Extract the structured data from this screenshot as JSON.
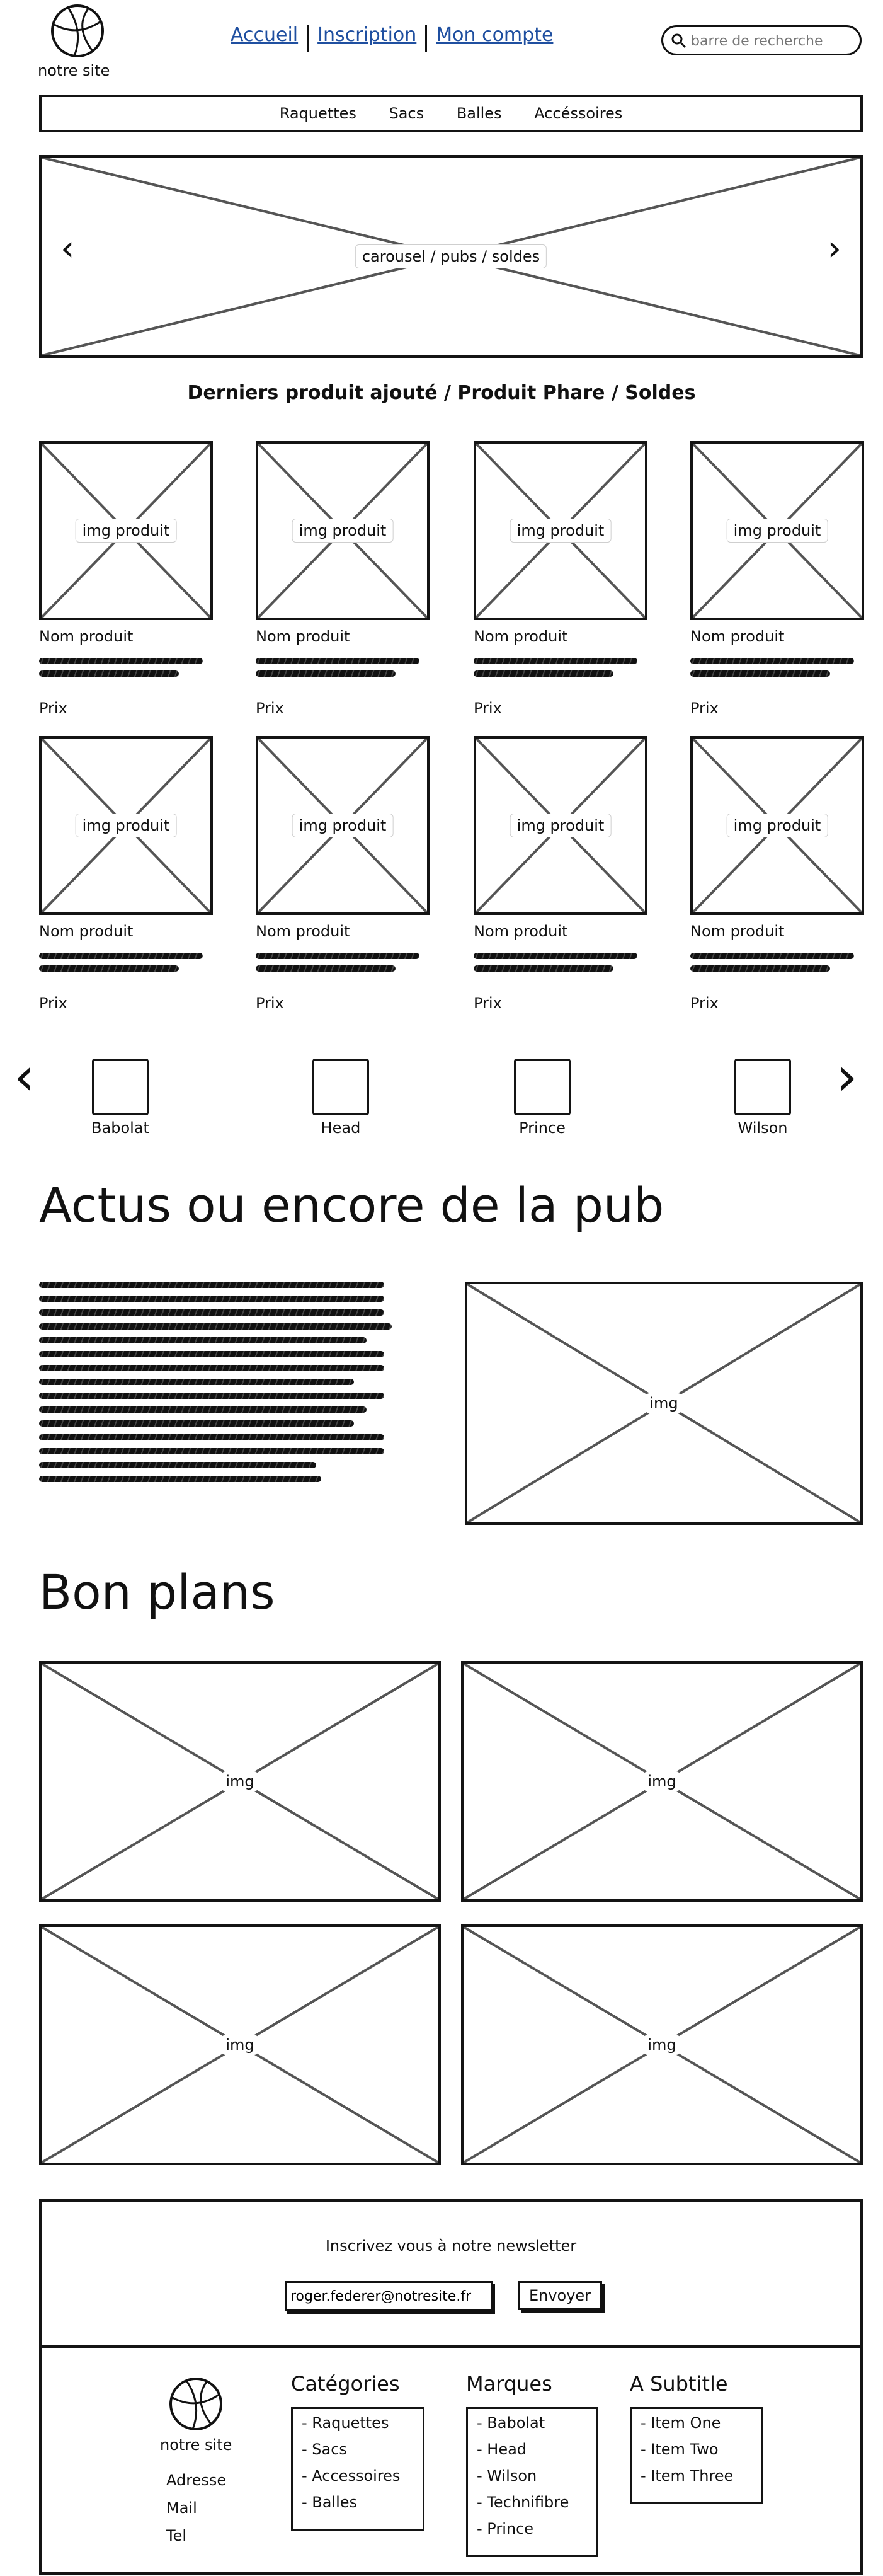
{
  "header": {
    "logo_text": "notre site",
    "nav_links": [
      "Accueil",
      "Inscription",
      "Mon compte"
    ],
    "search_placeholder": "barre de recherche"
  },
  "menu": {
    "items": [
      "Raquettes",
      "Sacs",
      "Balles",
      "Accéssoires"
    ]
  },
  "carousel": {
    "label": "carousel / pubs / soldes",
    "prev": "‹",
    "next": "›"
  },
  "products": {
    "heading": "Derniers produit ajouté / Produit Phare / Soldes",
    "img_label": "img produit",
    "name": "Nom produit",
    "price": "Prix"
  },
  "brands": {
    "items": [
      "Babolat",
      "Head",
      "Prince",
      "Wilson"
    ],
    "prev": "‹",
    "next": "›"
  },
  "news": {
    "title": "Actus ou encore de la pub",
    "img_label": "img"
  },
  "deals": {
    "title": "Bon plans",
    "img_label": "img"
  },
  "newsletter": {
    "text": "Inscrivez vous à notre newsletter",
    "email_value": "roger.federer@notresite.fr",
    "button": "Envoyer"
  },
  "footer": {
    "logo_text": "notre site",
    "contact": [
      "Adresse",
      "Mail",
      "Tel"
    ],
    "columns": [
      {
        "title": "Catégories",
        "items": [
          "- Raquettes",
          "- Sacs",
          "- Accessoires",
          "- Balles"
        ]
      },
      {
        "title": "Marques",
        "items": [
          "- Babolat",
          "- Head",
          "- Wilson",
          "- Technifibre",
          "- Prince"
        ]
      },
      {
        "title": "A Subtitle",
        "items": [
          "- Item One",
          "- Item Two",
          "- Item Three"
        ]
      }
    ]
  }
}
